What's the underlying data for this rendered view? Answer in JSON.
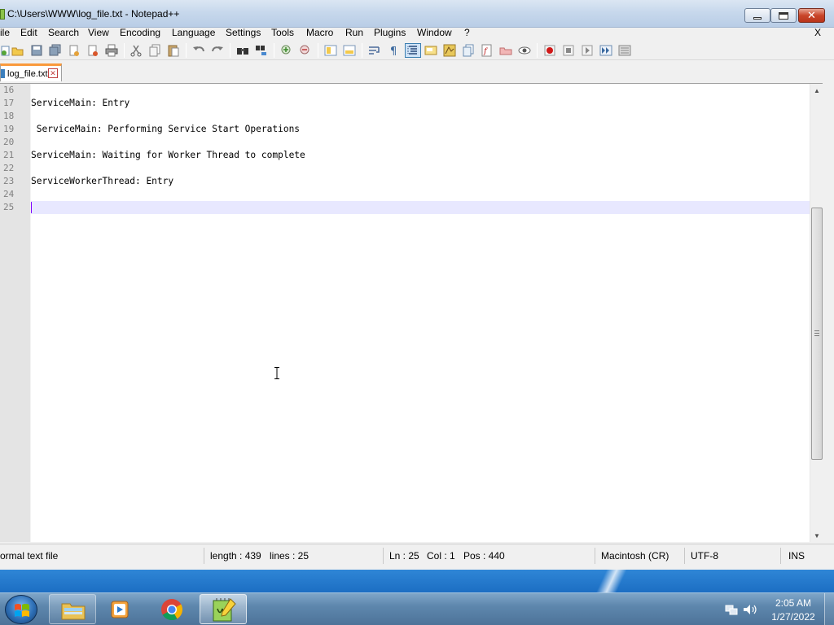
{
  "window": {
    "title": "C:\\Users\\WWW\\log_file.txt - Notepad++",
    "controls": {
      "minimize_icon": "minimize-icon",
      "maximize_icon": "restore-icon",
      "close_icon": "close-icon"
    }
  },
  "menu": {
    "items": [
      "ile",
      "Edit",
      "Search",
      "View",
      "Encoding",
      "Language",
      "Settings",
      "Tools",
      "Macro",
      "Run",
      "Plugins",
      "Window",
      "?"
    ],
    "close_doc": "X"
  },
  "toolbar": {
    "icons": [
      "new-file-icon",
      "open-file-icon",
      "save-icon",
      "save-all-icon",
      "close-icon",
      "close-all-icon",
      "print-icon",
      "cut-icon",
      "copy-icon",
      "paste-icon",
      "undo-icon",
      "redo-icon",
      "find-icon",
      "replace-icon",
      "zoom-in-icon",
      "zoom-out-icon",
      "sync-vertical-icon",
      "sync-horizontal-icon",
      "word-wrap-icon",
      "show-all-characters-icon",
      "indent-guide-icon",
      "user-defined-language-icon",
      "document-map-icon",
      "document-list-icon",
      "function-list-icon",
      "folder-as-workspace-icon",
      "monitoring-icon",
      "record-macro-icon",
      "stop-macro-icon",
      "play-macro-icon",
      "run-macro-multiple-icon",
      "save-macro-icon"
    ]
  },
  "tabs": [
    {
      "label": "log_file.txt",
      "active": true
    }
  ],
  "editor": {
    "lines": [
      {
        "num": "16",
        "text": ""
      },
      {
        "num": "17",
        "text": "ServiceMain: Entry"
      },
      {
        "num": "18",
        "text": ""
      },
      {
        "num": "19",
        "text": " ServiceMain: Performing Service Start Operations"
      },
      {
        "num": "20",
        "text": ""
      },
      {
        "num": "21",
        "text": "ServiceMain: Waiting for Worker Thread to complete"
      },
      {
        "num": "22",
        "text": ""
      },
      {
        "num": "23",
        "text": "ServiceWorkerThread: Entry"
      },
      {
        "num": "24",
        "text": ""
      },
      {
        "num": "25",
        "text": ""
      }
    ],
    "current_line": "25",
    "colors": {
      "current_line_bg": "#e8e8ff",
      "caret": "#8000ff",
      "line_number": "#808080"
    }
  },
  "statusbar": {
    "file_type": "ormal text file",
    "length": "length : 439",
    "lines": "lines : 25",
    "ln": "Ln : 25",
    "col": "Col : 1",
    "pos": "Pos : 440",
    "eol": "Macintosh (CR)",
    "encoding": "UTF-8",
    "mode": "INS"
  },
  "taskbar": {
    "apps": [
      {
        "name": "windows-explorer-icon",
        "active": false
      },
      {
        "name": "media-player-icon",
        "active": false
      },
      {
        "name": "chrome-icon",
        "active": false
      },
      {
        "name": "notepad-plus-plus-icon",
        "active": true
      }
    ],
    "clock": {
      "time": "2:05 AM",
      "date": "1/27/2022"
    },
    "tray": [
      "network-icon",
      "volume-icon"
    ]
  }
}
